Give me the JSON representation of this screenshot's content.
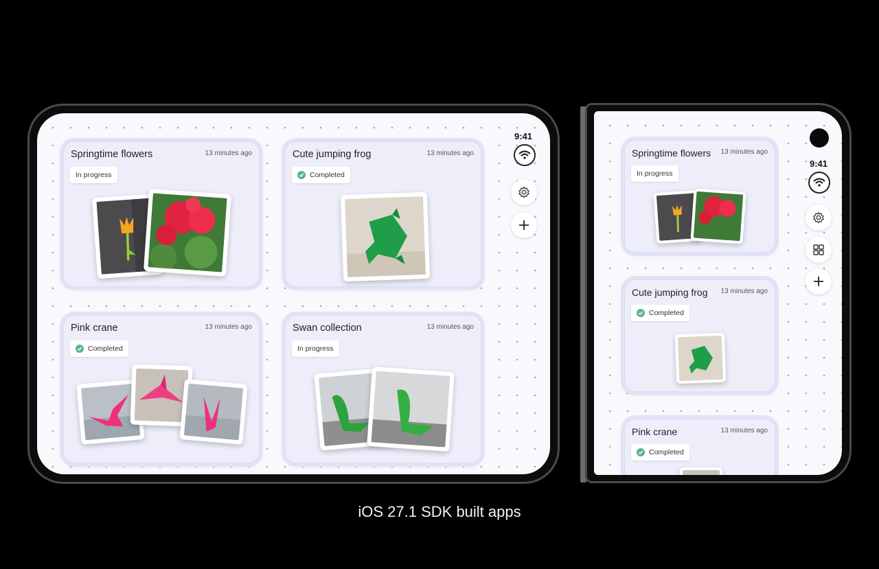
{
  "status_bar": {
    "time": "9:41"
  },
  "caption": "iOS 27.1 SDK built apps",
  "cards": [
    {
      "title": "Springtime flowers",
      "time": "13 minutes ago",
      "status": "In progress"
    },
    {
      "title": "Cute jumping frog",
      "time": "13 minutes ago",
      "status": "Completed"
    },
    {
      "title": "Pink crane",
      "time": "13 minutes ago",
      "status": "Completed"
    },
    {
      "title": "Swan collection",
      "time": "13 minutes ago",
      "status": "In progress"
    }
  ],
  "sidebar_icons": [
    "wifi-icon",
    "gear-icon",
    "grid-icon",
    "plus-icon"
  ],
  "colors": {
    "completed_check": "#58b394",
    "card_bg": "#eeeefb",
    "dots": "#7fc2b3"
  }
}
